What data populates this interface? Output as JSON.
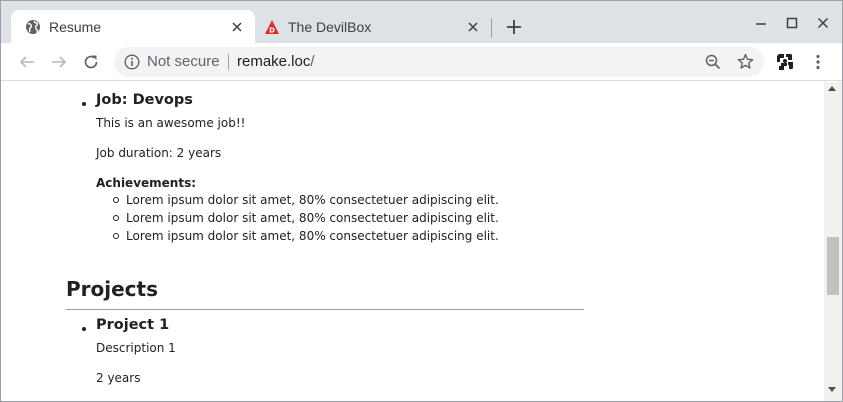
{
  "browser": {
    "tabs": [
      {
        "title": "Resume",
        "icon": "globe-icon",
        "active": true
      },
      {
        "title": "The DevilBox",
        "icon": "devilbox-favicon",
        "active": false
      }
    ],
    "omnibox": {
      "security_label": "Not secure",
      "url_host": "remake.loc",
      "url_path": "/"
    },
    "accent_colors": {
      "favicon_red": "#d93025",
      "tabstrip": "#dee1e6"
    }
  },
  "page": {
    "job": {
      "title": "Job: Devops",
      "description": "This is an awesome job!!",
      "duration": "Job duration: 2 years",
      "achievements_label": "Achievements:",
      "achievements": [
        "Lorem ipsum dolor sit amet, 80% consectetuer adipiscing elit.",
        "Lorem ipsum dolor sit amet, 80% consectetuer adipiscing elit.",
        "Lorem ipsum dolor sit amet, 80% consectetuer adipiscing elit."
      ]
    },
    "projects_heading": "Projects",
    "project": {
      "title": "Project 1",
      "description": "Description 1",
      "duration": "2 years"
    }
  }
}
